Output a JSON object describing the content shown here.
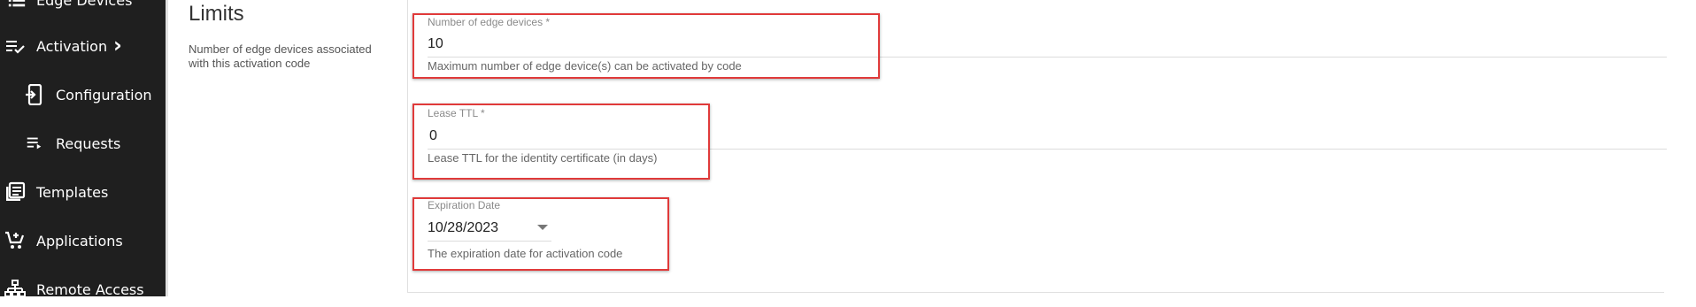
{
  "sidebar": {
    "items": [
      {
        "label": "Edge Devices",
        "icon": "list-icon"
      },
      {
        "label": "Activation",
        "icon": "checklist-icon"
      },
      {
        "label": "Configuration",
        "icon": "device-add-icon"
      },
      {
        "label": "Requests",
        "icon": "playlist-icon"
      },
      {
        "label": "Templates",
        "icon": "library-books-icon"
      },
      {
        "label": "Applications",
        "icon": "add-cart-icon"
      },
      {
        "label": "Remote Access",
        "icon": "network-icon"
      }
    ],
    "activation_chevron": "›"
  },
  "section": {
    "title": "Limits",
    "description": "Number of edge devices associated with this activation code"
  },
  "fields": {
    "edge_devices": {
      "label": "Number of edge devices *",
      "value": "10",
      "hint": "Maximum number of edge device(s) can be activated by code"
    },
    "lease_ttl": {
      "label": "Lease TTL *",
      "value": "0",
      "hint": "Lease TTL for the identity certificate (in days)"
    },
    "expiration_date": {
      "label": "Expiration Date",
      "value": "10/28/2023",
      "hint": "The expiration date for activation code"
    }
  },
  "colors": {
    "sidebar_bg": "#1f1f1f",
    "highlight": "#e03a3a"
  }
}
